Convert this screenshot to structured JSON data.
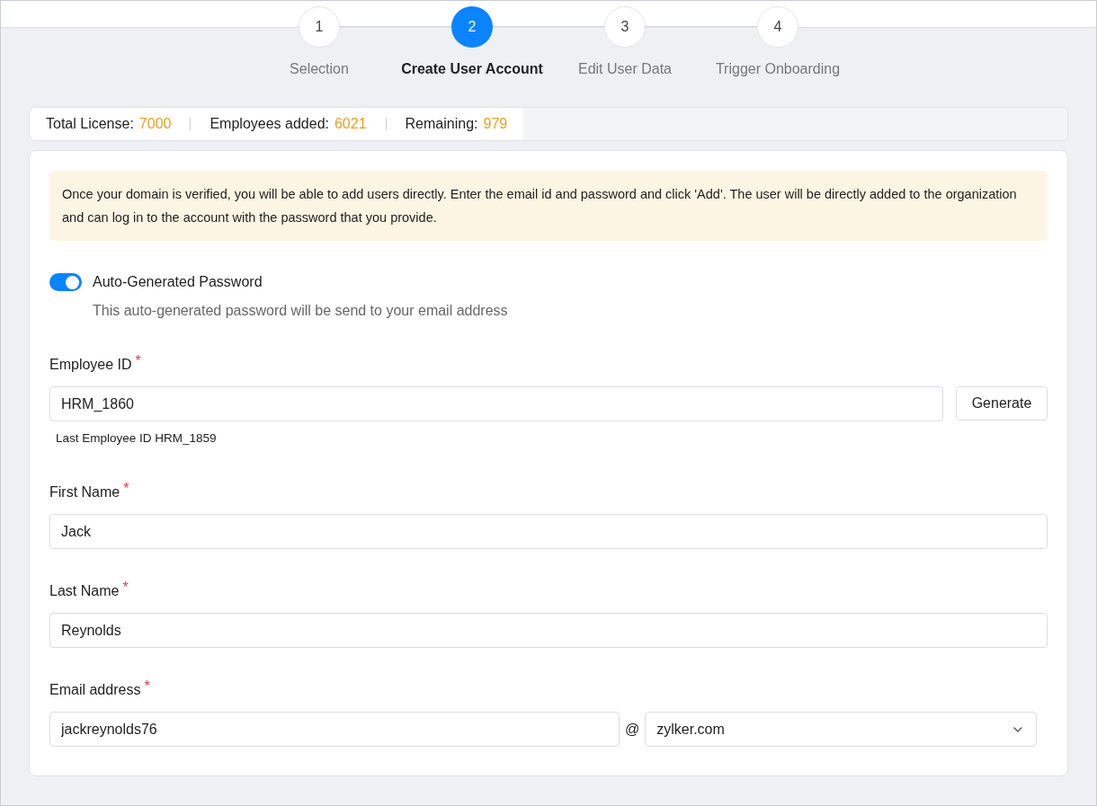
{
  "steps": [
    {
      "number": "1",
      "label": "Selection",
      "selected": false
    },
    {
      "number": "2",
      "label": "Create User Account",
      "selected": true
    },
    {
      "number": "3",
      "label": "Edit User Data",
      "selected": false
    },
    {
      "number": "4",
      "label": "Trigger Onboarding",
      "selected": false
    }
  ],
  "license": [
    {
      "label": "Total License:",
      "value": "7000"
    },
    {
      "label": "Employees added:",
      "value": "6021"
    },
    {
      "label": "Remaining:",
      "value": "979"
    }
  ],
  "notice": "Once your domain is verified, you will be able to add users directly. Enter the email id and password and click 'Add'. The user will be directly added to the organization and can log in to the account with the password that you provide.",
  "auto_password": {
    "label": "Auto-Generated Password",
    "on": true,
    "description": "This auto-generated password will be send to your email address"
  },
  "employee_id": {
    "label": "Employee ID",
    "required_mark": "*",
    "value": "HRM_1860",
    "button": "Generate",
    "hint": "Last Employee ID HRM_1859"
  },
  "first_name": {
    "label": "First Name",
    "required_mark": "*",
    "value": "Jack"
  },
  "last_name": {
    "label": "Last Name",
    "required_mark": "*",
    "value": "Reynolds"
  },
  "email": {
    "label": "Email address",
    "required_mark": "*",
    "value": "jackreynolds76",
    "at": "@",
    "domain": "zylker.com"
  }
}
